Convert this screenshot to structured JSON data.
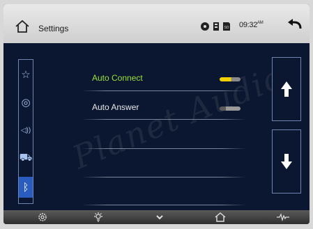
{
  "header": {
    "title": "Settings",
    "time": "09:32",
    "time_suffix": "AM",
    "status_icons": [
      "disc-icon",
      "usb-icon",
      "sd-card-icon"
    ],
    "sd_label": "SD"
  },
  "sidebar": {
    "items": [
      {
        "icon": "star-icon",
        "glyph": "☆",
        "active": false
      },
      {
        "icon": "disc-icon",
        "glyph": "◎",
        "active": false
      },
      {
        "icon": "speaker-icon",
        "glyph": "◁))",
        "active": false
      },
      {
        "icon": "car-icon",
        "glyph": "⛟",
        "active": false
      },
      {
        "icon": "bluetooth-icon",
        "glyph": "ᛒ",
        "active": true
      }
    ]
  },
  "settings": [
    {
      "label": "Auto Connect",
      "enabled": true,
      "highlighted": true
    },
    {
      "label": "Auto Answer",
      "enabled": false,
      "highlighted": false
    }
  ],
  "bottom_nav": [
    {
      "icon": "gear-icon"
    },
    {
      "icon": "brightness-icon"
    },
    {
      "icon": "chevron-down-icon"
    },
    {
      "icon": "home-icon"
    },
    {
      "icon": "equalizer-icon"
    }
  ],
  "watermark": "Planet Audio",
  "colors": {
    "background": "#0b1730",
    "accent_green": "#9be03a",
    "toggle_on": "#f2d100",
    "active_tab": "#2a5bbf"
  }
}
